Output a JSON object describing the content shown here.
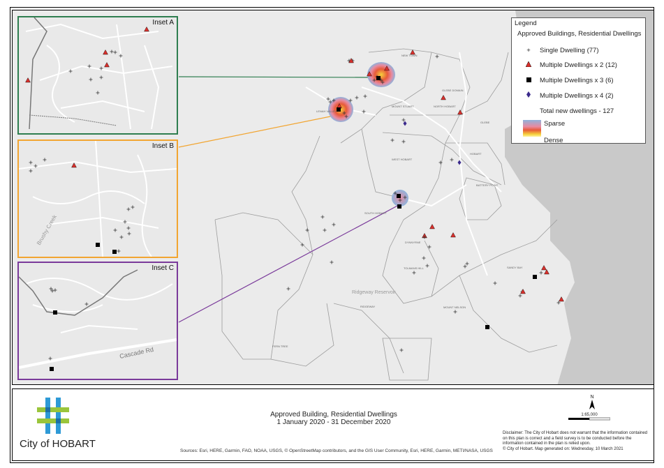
{
  "insets": [
    {
      "title": "Inset A",
      "color": "#2e7d4f"
    },
    {
      "title": "Inset B",
      "color": "#f2a531"
    },
    {
      "title": "Inset C",
      "color": "#7a3a9a"
    }
  ],
  "inset_labels": {
    "b_road": "Brushy Creek",
    "c_road": "Cascade Rd"
  },
  "legend": {
    "title": "Legend",
    "subtitle": "Approved Buildings, Residential Dwellings",
    "items": [
      {
        "symbol": "plus",
        "label": "Single Dwelling (77)"
      },
      {
        "symbol": "triangle",
        "label": "Multiple Dwellings x 2 (12)"
      },
      {
        "symbol": "square",
        "label": "Multiple Dwellings x 3 (6)"
      },
      {
        "symbol": "diamond",
        "label": "Multiple Dwellings x 4 (2)"
      }
    ],
    "total": "Total new dwellings - 127",
    "ramp_low": "Sparse",
    "ramp_high": "Dense"
  },
  "map_labels": {
    "new_town": "NEW TOWN",
    "glebe_domain": "GLEBE DOMAIN",
    "mount_stuart": "MOUNT STUART",
    "north_hobart": "NORTH HOBART",
    "lenah_valley": "LENAH VALLEY",
    "west_hobart": "WEST HOBART",
    "hobart": "HOBART",
    "battery_point": "BATTERY POINT",
    "south_hobart": "SOUTH HOBART",
    "dynnyrne": "DYNNYRNE",
    "tolmans_hill": "TOLMANS HILL",
    "sandy_bay": "SANDY BAY",
    "mount_nelson": "MOUNT NELSON",
    "ridgeway": "RIDGEWAY",
    "fern_tree": "FERN TREE",
    "ridgeway_reservoir": "Ridgeway Reservoir",
    "glebe": "GLEBE"
  },
  "footer": {
    "logo_text": "City of HOBART",
    "title_line1": "Approved Building, Residential Dwellings",
    "title_line2": "1 January 2020  - 31 December 2020",
    "north": "N",
    "scale": "1:65,000",
    "sources": "Sources: Esri, HERE, Garmin, FAO, NOAA, USGS, © OpenStreetMap contributors, and the GIS User Community, Esri, HERE, Garmin, METI/NASA, USGS",
    "disclaimer": "Disclaimer: The City of Hobart does not warrant that the information contained on this plan is correct and a field survey is to be conducted before the information contained in the plan is relied upon.",
    "copyright": "© City of Hobart. Map generated on: Wednesday, 10 March 2021"
  },
  "colors": {
    "triangle": "#d9302c",
    "square": "#000000",
    "diamond": "#3b2a8c",
    "water": "#c9c9c9"
  }
}
